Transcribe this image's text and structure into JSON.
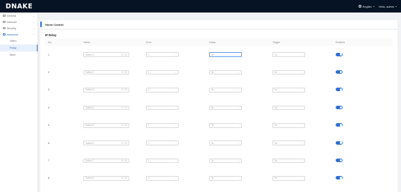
{
  "app": {
    "logo": "DNAKE",
    "language": "English",
    "user": "Hello, admin"
  },
  "sidebar": {
    "items": [
      {
        "label": "General",
        "icon": "grid-icon",
        "expanded": false
      },
      {
        "label": "Intercom",
        "icon": "phone-icon",
        "expanded": false
      },
      {
        "label": "Security",
        "icon": "shield-icon",
        "expanded": false
      },
      {
        "label": "Advanced",
        "icon": "settings-icon",
        "expanded": true
      }
    ],
    "subitems": [
      {
        "label": "Video",
        "active": false
      },
      {
        "label": "Relay",
        "active": true
      },
      {
        "label": "More",
        "active": false
      }
    ]
  },
  "breadcrumb": "Home Control",
  "section_title": "IP Relay",
  "table": {
    "headers": [
      "No.",
      "Name",
      "Door",
      "Delay",
      "Trigger",
      "Enabled"
    ],
    "rows": [
      {
        "no": "1",
        "name": "Switch 1",
        "count": "8 / 20",
        "door": "1",
        "delay": "3s",
        "trigger": "3s",
        "enabled": true
      },
      {
        "no": "2",
        "name": "Switch 2",
        "count": "8 / 20",
        "door": "1",
        "delay": "3s",
        "trigger": "3s",
        "enabled": true
      },
      {
        "no": "3",
        "name": "Switch 3",
        "count": "8 / 20",
        "door": "1",
        "delay": "3s",
        "trigger": "3s",
        "enabled": true
      },
      {
        "no": "4",
        "name": "Switch 4",
        "count": "8 / 20",
        "door": "1",
        "delay": "3s",
        "trigger": "3s",
        "enabled": true
      },
      {
        "no": "5",
        "name": "Switch 5",
        "count": "8 / 20",
        "door": "1",
        "delay": "3s",
        "trigger": "3s",
        "enabled": true
      },
      {
        "no": "6",
        "name": "Switch 6",
        "count": "8 / 20",
        "door": "1",
        "delay": "3s",
        "trigger": "3s",
        "enabled": true
      },
      {
        "no": "7",
        "name": "Switch 7",
        "count": "8 / 20",
        "door": "1",
        "delay": "3s",
        "trigger": "3s",
        "enabled": true
      },
      {
        "no": "8",
        "name": "Switch 8",
        "count": "8 / 20",
        "door": "4",
        "delay": "3s",
        "trigger": "3s",
        "enabled": true
      }
    ]
  },
  "colors": {
    "topbar": "#061324",
    "accent": "#2b6fd6"
  }
}
